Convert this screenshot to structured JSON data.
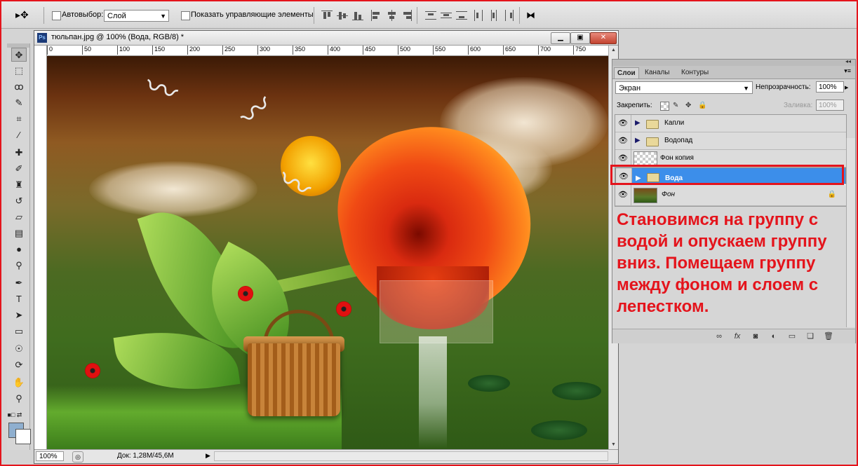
{
  "options_bar": {
    "auto_select_label": "Автовыбор:",
    "auto_select_value": "Слой",
    "show_controls_label": "Показать управляющие элементы"
  },
  "document": {
    "title": "тюльпан.jpg @ 100% (Вода, RGB/8) *",
    "ps_badge": "Ps",
    "ruler_ticks": [
      "0",
      "50",
      "100",
      "150",
      "200",
      "250",
      "300",
      "350",
      "400",
      "450",
      "500",
      "550",
      "600",
      "650",
      "700",
      "750"
    ],
    "zoom": "100%",
    "doc_info": "Док: 1,28M/45,6M"
  },
  "layers_panel": {
    "tabs": [
      "Слои",
      "Каналы",
      "Контуры"
    ],
    "blend_mode": "Экран",
    "opacity_label": "Непрозрачность:",
    "opacity_value": "100%",
    "lock_label": "Закрепить:",
    "fill_label": "Заливка:",
    "fill_value": "100%",
    "layers": [
      {
        "name": "Капли",
        "type": "group",
        "selected": false
      },
      {
        "name": "Водопад",
        "type": "group",
        "selected": false
      },
      {
        "name": "Фон копия",
        "type": "layer",
        "selected": false
      },
      {
        "name": "Вода",
        "type": "group",
        "selected": true
      },
      {
        "name": "Фон",
        "type": "background",
        "selected": false,
        "locked": true
      }
    ]
  },
  "annotation": {
    "text": "Становимся на группу с водой и опускаем группу вниз. Помещаем группу между фоном и слоем с лепестком."
  },
  "colors": {
    "highlight_red": "#e4141c",
    "selected_layer": "#3c8eea",
    "foreground": "#8fafcf",
    "background": "#ffffff"
  }
}
